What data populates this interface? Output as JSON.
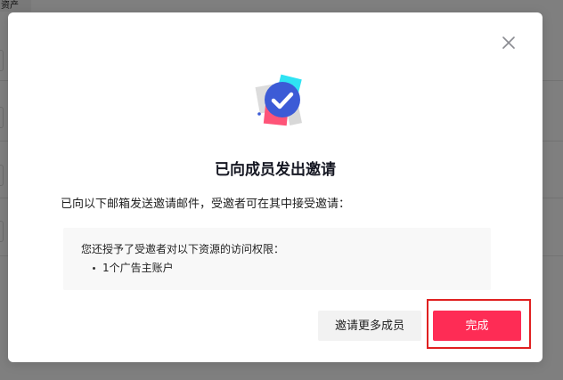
{
  "background": {
    "tab_label": "资产"
  },
  "modal": {
    "title": "已向成员发出邀请",
    "description": "已向以下邮箱发送邀请邮件，受邀者可在其中接受邀请：",
    "info": {
      "heading": "您还授予了受邀者对以下资源的访问权限：",
      "items": [
        {
          "label": "1个广告主账户"
        }
      ]
    },
    "buttons": {
      "invite_more": "邀请更多成员",
      "done": "完成"
    }
  },
  "icons": {
    "close": "close-icon",
    "illustration": "invitation-sent-checkmark-icon"
  },
  "colors": {
    "primary": "#fe2c55",
    "check_circle": "#3c5bd6",
    "card_cyan": "#2fe3f3",
    "card_pink": "#fe5478",
    "highlight": "#e02020",
    "overlay": "rgba(0,0,0,0.5)"
  }
}
